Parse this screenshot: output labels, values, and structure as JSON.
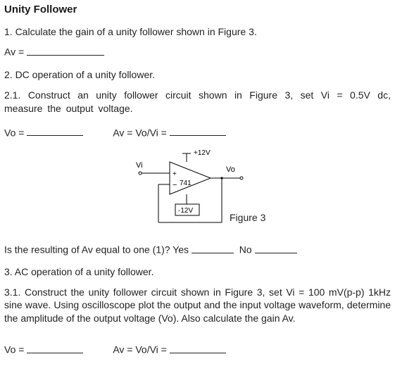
{
  "title": "Unity Follower",
  "q1": {
    "prompt": "1. Calculate the gain of a unity follower shown in Figure 3.",
    "av_label": "Av ="
  },
  "q2": {
    "prompt": "2. DC operation of a unity follower."
  },
  "q21": {
    "prompt": "2.1. Construct an unity follower circuit shown in Figure 3, set Vi = 0.5V dc, measure the output voltage."
  },
  "measure1": {
    "vo_label": "Vo =",
    "av_label": "Av = Vo/Vi ="
  },
  "figure": {
    "caption": "Figure 3",
    "vi": "Vi",
    "vo": "Vo",
    "plus12": "+12V",
    "minus12": "-12V",
    "ic": "741"
  },
  "check": {
    "prompt": "Is the resulting of Av equal to one (1)? Yes",
    "no_label": "No"
  },
  "q3": {
    "prompt": "3.  AC operation of a unity follower."
  },
  "q31": {
    "prompt": "3.1. Construct the unity follower circuit shown in Figure 3, set Vi = 100 mV(p-p) 1kHz sine wave. Using oscilloscope plot the output and the input voltage waveform, determine the amplitude of the output voltage (Vo). Also calculate the gain Av."
  },
  "measure2": {
    "vo_label": "Vo =",
    "av_label": "Av = Vo/Vi ="
  },
  "chart_data": {
    "type": "diagram",
    "description": "Op-amp 741 unity follower (voltage follower) circuit",
    "nodes": {
      "Vi": "non-inverting input terminal (left, top input of op-amp)",
      "Vo": "output terminal (right)",
      "V+": "+12V supply rail (top of op-amp)",
      "V-": "-12V supply rail (bottom of op-amp)",
      "inverting_input": "connected via feedback to output"
    },
    "connections": [
      [
        "Vi",
        "opamp_noninverting"
      ],
      [
        "opamp_output",
        "Vo"
      ],
      [
        "opamp_output",
        "opamp_inverting"
      ],
      [
        "V+",
        "opamp_vcc+"
      ],
      [
        "V-",
        "opamp_vcc-"
      ]
    ],
    "ic": "741"
  }
}
